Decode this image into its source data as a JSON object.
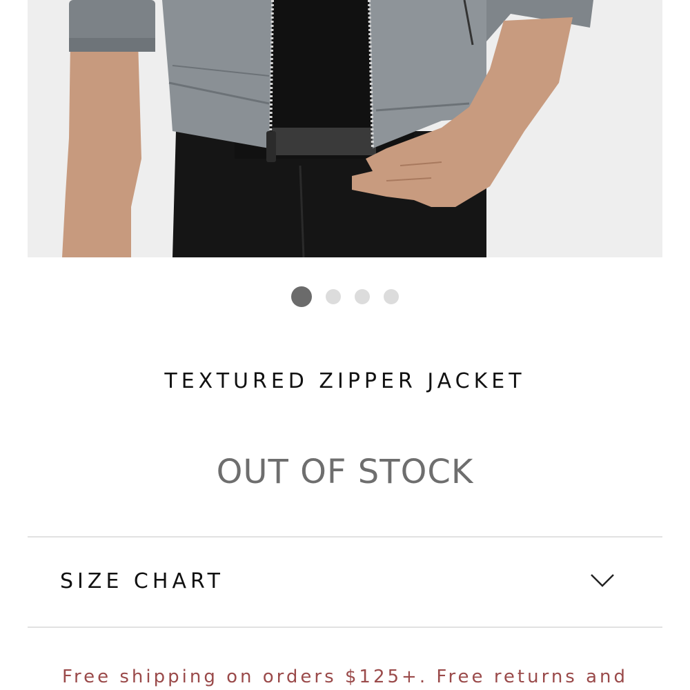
{
  "product": {
    "image_alt": "Man wearing grey textured zipper jacket over black shirt and black jeans",
    "title": "TEXTURED ZIPPER JACKET",
    "status": "OUT OF STOCK"
  },
  "carousel": {
    "total": 4,
    "active_index": 0
  },
  "size_chart": {
    "label": "SIZE CHART",
    "icon": "chevron-down-icon"
  },
  "shipping": {
    "text": "Free shipping on orders $125+. Free returns and"
  },
  "colors": {
    "status_text": "#6e6e6e",
    "shipping_text": "#9a4a4a",
    "dot_active": "#6b6b6b",
    "dot_inactive": "#dcdcdc",
    "divider": "#e1e1e1"
  }
}
